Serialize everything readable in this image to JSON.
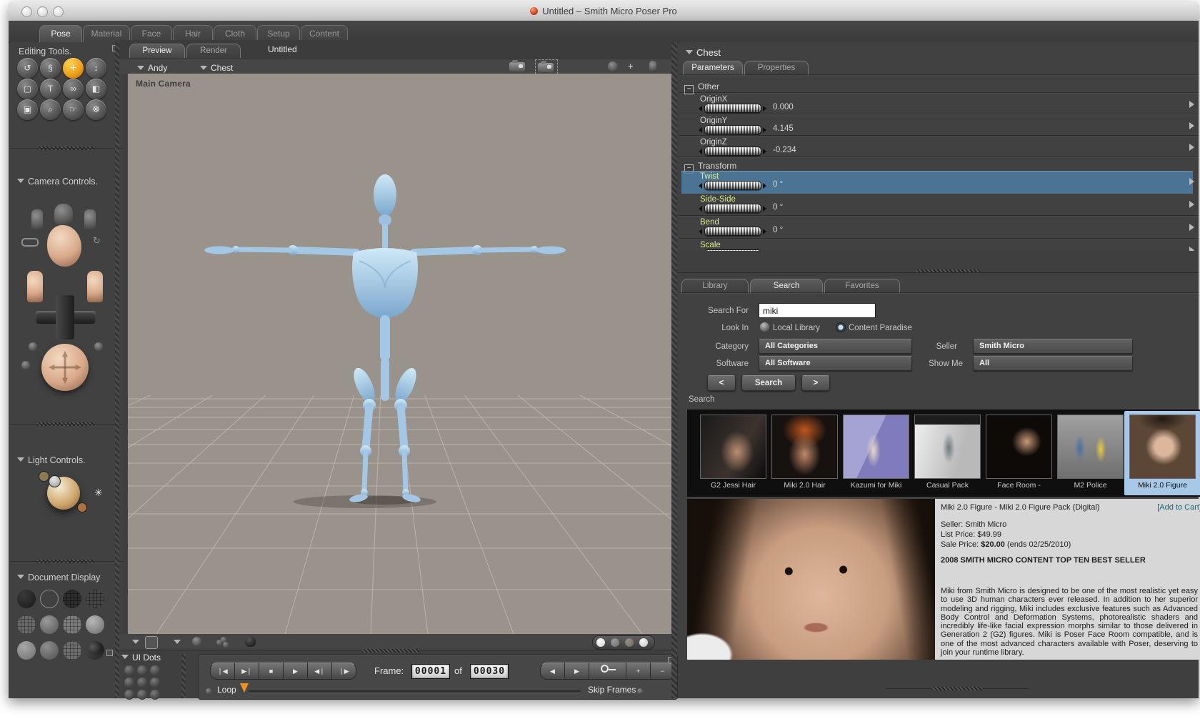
{
  "window": {
    "title": "Untitled – Smith Micro Poser Pro"
  },
  "rooms": {
    "tabs": [
      "Pose",
      "Material",
      "Face",
      "Hair",
      "Cloth",
      "Setup",
      "Content"
    ]
  },
  "sidebar": {
    "editing_tools_label": "Editing Tools.",
    "camera_controls_label": "Camera Controls.",
    "light_controls_label": "Light Controls.",
    "document_display_label": "Document Display",
    "tools": [
      {
        "name": "rotate",
        "glyph": "↺"
      },
      {
        "name": "twist",
        "glyph": "§"
      },
      {
        "name": "translate-pull",
        "glyph": "+"
      },
      {
        "name": "translate-in-out",
        "glyph": "↕"
      },
      {
        "name": "scale",
        "glyph": "▢"
      },
      {
        "name": "taper",
        "glyph": "T"
      },
      {
        "name": "chain-break",
        "glyph": "∞"
      },
      {
        "name": "color",
        "glyph": "◧"
      },
      {
        "name": "morphing",
        "glyph": "▣"
      },
      {
        "name": "view-magnifier",
        "glyph": "⌕"
      },
      {
        "name": "grouping",
        "glyph": "☞"
      },
      {
        "name": "direct-manipulation",
        "glyph": "☸"
      }
    ]
  },
  "viewport": {
    "view_tabs": [
      "Preview",
      "Render"
    ],
    "doc_title": "Untitled",
    "actor": "Andy",
    "part": "Chest",
    "camera_label": "Main Camera"
  },
  "params": {
    "header": "Chest",
    "tabs": [
      "Parameters",
      "Properties"
    ],
    "group1": "Other",
    "rows1": [
      {
        "label": "OriginX",
        "value": "0.000"
      },
      {
        "label": "OriginY",
        "value": "4.145"
      },
      {
        "label": "OriginZ",
        "value": "-0.234"
      }
    ],
    "group2": "Transform",
    "rows2": [
      {
        "label": "Twist",
        "value": "0 °"
      },
      {
        "label": "Side-Side",
        "value": "0 °"
      },
      {
        "label": "Bend",
        "value": "0 °"
      },
      {
        "label": "Scale",
        "value": ""
      }
    ]
  },
  "library": {
    "tabs": [
      "Library",
      "Search",
      "Favorites"
    ],
    "search_for_label": "Search For",
    "search_value": "miki",
    "look_in_label": "Look In",
    "option_local": "Local Library",
    "option_paradise": "Content Paradise",
    "category_label": "Category",
    "category_value": "All Categories",
    "seller_label": "Seller",
    "seller_value": "Smith Micro",
    "software_label": "Software",
    "software_value": "All Software",
    "show_me_label": "Show Me",
    "show_me_value": "All",
    "prev": "<",
    "search_btn": "Search",
    "next": ">",
    "results_label": "Search",
    "results": [
      {
        "caption": "G2 Jessi Hair"
      },
      {
        "caption": "Miki 2.0 Hair"
      },
      {
        "caption": "Kazumi for Miki"
      },
      {
        "caption": "Casual Pack"
      },
      {
        "caption": "Face Room -"
      },
      {
        "caption": "M2 Police"
      },
      {
        "caption": "Miki 2.0 Figure"
      }
    ]
  },
  "product": {
    "title": "Miki 2.0 Figure - Miki 2.0 Figure Pack (Digital)",
    "add_to_cart": "[Add to Cart]",
    "seller": "Seller: Smith Micro",
    "list_price": "List Price: $49.99",
    "sale_label": "Sale Price:",
    "sale_value": "$20.00",
    "sale_suffix": "(ends 02/25/2010)",
    "banner": "2008 SMITH MICRO CONTENT TOP TEN BEST SELLER",
    "description": "Miki from Smith Micro is designed to be one of the most realistic yet easy to use 3D human characters ever released. In addition to her superior modeling and rigging, Miki includes exclusive features such as Advanced Body Control and Deformation Systems, photorealistic shaders and incredibly life-like facial expression morphs similar to those delivered in Generation 2 (G2) figures. Miki is Poser Face Room compatible, and is one of the most advanced characters available with Poser, deserving to join your runtime library."
  },
  "transport": {
    "ui_dots": "UI Dots",
    "frame_label": "Frame:",
    "current": "00001",
    "of": "of",
    "total": "00030",
    "loop": "Loop",
    "skip": "Skip Frames"
  }
}
